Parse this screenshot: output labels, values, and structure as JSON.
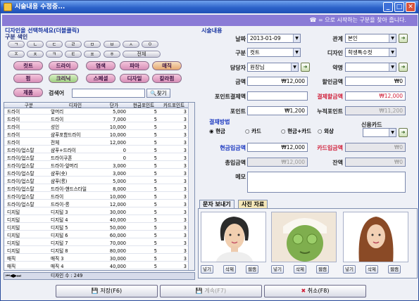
{
  "window": {
    "title": "시술내용 수정중..."
  },
  "banner": {
    "text": "☎ = 으로 시작하는 구분을 찾아 줍니다."
  },
  "left": {
    "header": "디자인을 선택하세요(더블클릭)",
    "subheader": "구분 색인",
    "consonants": [
      "ㄱ",
      "ㄴ",
      "ㄷ",
      "ㄹ",
      "ㅁ",
      "ㅂ",
      "ㅅ",
      "ㅇ",
      "ㅈ",
      "ㅊ",
      "ㅋ",
      "ㅌ",
      "ㅍ",
      "ㅎ",
      "전체"
    ],
    "categories": [
      "컷트",
      "드라이",
      "염색",
      "파마",
      "매직",
      "펌",
      "크리닉",
      "스페셜",
      "디자일",
      "칼라펌",
      "제품"
    ],
    "search_label": "검색어",
    "search_value": "",
    "search_button": "찾기",
    "grid_headers": [
      "구분",
      "디자인",
      "단가",
      "현금포인트",
      "카드포인트"
    ],
    "rows": [
      [
        "드라이",
        "앞머리",
        "5,000",
        "5",
        "3"
      ],
      [
        "드라이",
        "드라이",
        "7,000",
        "5",
        "3"
      ],
      [
        "드라이",
        "성인",
        "10,000",
        "5",
        "3"
      ],
      [
        "드라이",
        "샴푸포함드라이",
        "10,000",
        "5",
        "3"
      ],
      [
        "드라이",
        "전체",
        "12,000",
        "5",
        "3"
      ],
      [
        "드라이/업스탈",
        "샴푸+드라이",
        "0",
        "5",
        "3"
      ],
      [
        "드라이/업스탈",
        "드라이쿠폰",
        "0",
        "5",
        "3"
      ],
      [
        "드라이/업스탈",
        "드라이-앞머리",
        "3,000",
        "5",
        "3"
      ],
      [
        "드라이/업스탈",
        "샴푸(숏)",
        "3,000",
        "5",
        "3"
      ],
      [
        "드라이/업스탈",
        "샴푸(롱)",
        "5,000",
        "5",
        "3"
      ],
      [
        "드라이/업스탈",
        "드라이-핸드스타일",
        "8,000",
        "5",
        "3"
      ],
      [
        "드라이/업스탈",
        "드라이",
        "10,000",
        "5",
        "3"
      ],
      [
        "드라이/업스탈",
        "드라이-롱",
        "12,000",
        "5",
        "3"
      ],
      [
        "디지털",
        "디지털 3",
        "30,000",
        "5",
        "3"
      ],
      [
        "디지털",
        "디지털 4",
        "40,000",
        "5",
        "3"
      ],
      [
        "디지털",
        "디지털 5",
        "50,000",
        "5",
        "3"
      ],
      [
        "디지털",
        "디지털 6",
        "60,000",
        "5",
        "3"
      ],
      [
        "디지털",
        "디지털 7",
        "70,000",
        "5",
        "3"
      ],
      [
        "디지털",
        "디지털 8",
        "80,000",
        "5",
        "3"
      ],
      [
        "매직",
        "매직 3",
        "30,000",
        "5",
        "3"
      ],
      [
        "매직",
        "매직 4",
        "40,000",
        "5",
        "3"
      ]
    ],
    "record_count": "디자인 수 : 249"
  },
  "right": {
    "section": "시술내용",
    "date_label": "날짜",
    "date": "2013-01-09",
    "relation_label": "관계",
    "relation": "본인",
    "category_label": "구분",
    "category": "컷트",
    "design_label": "디자인",
    "design": "학생특수컷",
    "staff_label": "담당자",
    "staff": "원장님",
    "drug_label": "약명",
    "drug": "",
    "amount_label": "금액",
    "amount": "₩12,000",
    "discount_label": "할인금액",
    "discount": "₩0",
    "point_pay_label": "포인트결제액",
    "point_pay": "",
    "payment_label": "결제할금액",
    "payment": "₩12,000",
    "point_label": "포인트",
    "point": "₩1,200",
    "accum_label": "누적포인트",
    "accum": "₩11,200",
    "pay_method_label": "결재방법",
    "pay_methods": [
      "현금",
      "카드",
      "현금+카드",
      "외상"
    ],
    "credit_card_label": "신용카드",
    "cash_in_label": "현금입금액",
    "cash_in": "₩12,000",
    "card_in_label": "카드입금액",
    "card_in": "₩0",
    "total_in_label": "총입금액",
    "total_in": "₩12,000",
    "balance_label": "잔액",
    "balance": "₩0",
    "memo_label": "메모",
    "memo": ""
  },
  "tabs": [
    "문자 보내기",
    "사진 자료"
  ],
  "photo_buttons": [
    "넣기",
    "삭제",
    "웹캠"
  ],
  "bottom": {
    "save": "저장(F6)",
    "continue": "계속(F7)",
    "cancel": "취소(F8)"
  }
}
